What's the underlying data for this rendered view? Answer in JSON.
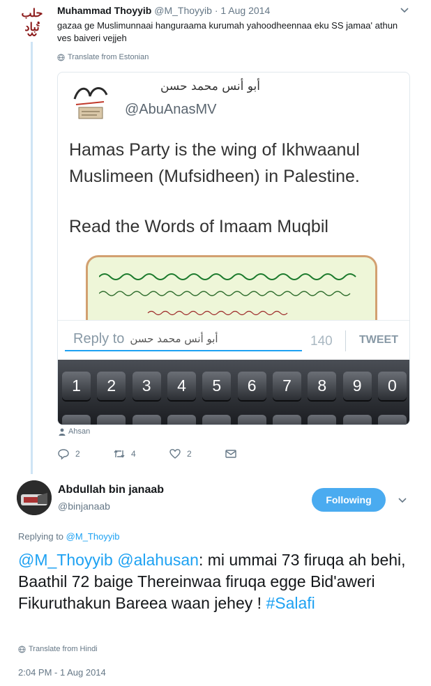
{
  "tweet1": {
    "avatar_text_top": "حلب",
    "avatar_text_bottom": "تُباد",
    "name": "Muhammad Thoyyib",
    "handle": "@M_Thoyyib",
    "separator": "·",
    "date": "1 Aug 2014",
    "text": "gazaa ge Muslimunnaai hanguraama kurumah yahoodheennaa eku SS jamaa' athun ves baiveri vejjeh",
    "translate_label": "Translate from Estonian",
    "media": {
      "arabic_name": "أبو أنس محمد حسن",
      "handle": "@AbuAnasMV",
      "line1": "Hamas Party is the wing of Ikhwaanul",
      "line2": "Muslimeen (Mufsidheen)  in Palestine.",
      "line3": "Read the Words of Imaam Muqbil",
      "reply_placeholder": "Reply to",
      "reply_arabic": "أبو أنس محمد حسن",
      "char_count": "140",
      "tweet_button": "TWEET",
      "keys": [
        "1",
        "2",
        "3",
        "4",
        "5",
        "6",
        "7",
        "8",
        "9",
        "0"
      ]
    },
    "credit": "Ahsan",
    "replies": "2",
    "retweets": "4",
    "likes": "2"
  },
  "tweet2": {
    "name": "Abdullah bin janaab",
    "handle": "@binjanaab",
    "follow_label": "Following",
    "replying_prefix": "Replying to",
    "replying_handle": "@M_Thoyyib",
    "mention1": "@M_Thoyyib",
    "mention2": "@alahusan",
    "body_text": ": mi ummai 73 firuqa ah behi, Baathil 72 baige Thereinwaa firuqa egge Bid'aweri Fikuruthakun Bareea waan jehey ! ",
    "hashtag": "#Salafi",
    "translate_label": "Translate from Hindi",
    "timestamp": "2:04 PM - 1 Aug 2014"
  },
  "colors": {
    "link_blue": "#1da1f2",
    "follow_button": "#4aabf0",
    "muted_text": "#657786",
    "thread_line": "#cfe4f5"
  }
}
